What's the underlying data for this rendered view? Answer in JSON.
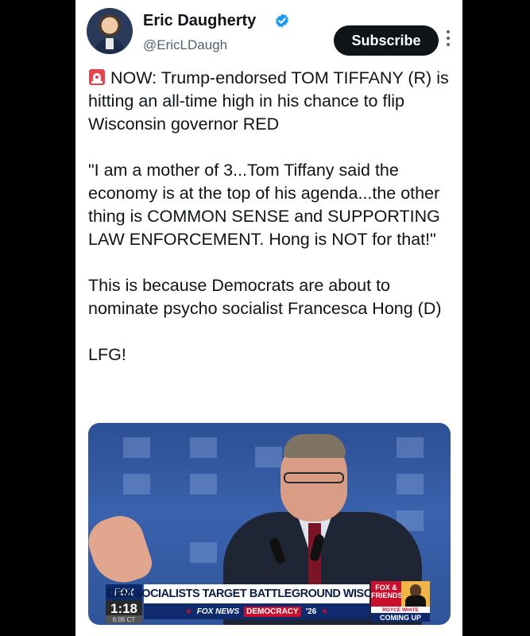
{
  "author": {
    "name": "Eric Daugherty",
    "handle": "@EricLDaugh",
    "verified": true,
    "verified_color": "#1d9bf0"
  },
  "actions": {
    "subscribe_label": "Subscribe"
  },
  "post": {
    "lead_icon": "siren-emoji",
    "paragraphs": [
      "NOW: Trump-endorsed TOM TIFFANY (R) is hitting an all-time high in his chance to flip Wisconsin governor RED",
      "\"I am a mother of 3...Tom Tiffany said the economy is at the top of his agenda...the other thing is COMMON SENSE and SUPPORTING LAW ENFORCEMENT. Hong is NOT for that!\"",
      "This is because Democrats are about to nominate psycho socialist Francesca Hong (D)",
      "LFG!"
    ]
  },
  "video": {
    "network_logo": "FOX",
    "clock": "1:18",
    "clock_small": "6:06 CT",
    "headline": "DEM SOCIALISTS TARGET BATTLEGROUND WISCONSIN",
    "subbar": {
      "brand": "FOX NEWS",
      "segment": "DEMOCRACY",
      "year": "'26"
    },
    "show_logo": "FOX & FRIENDS",
    "guest_name": "ROYCE WHITE",
    "coming_up": "COMING UP"
  }
}
